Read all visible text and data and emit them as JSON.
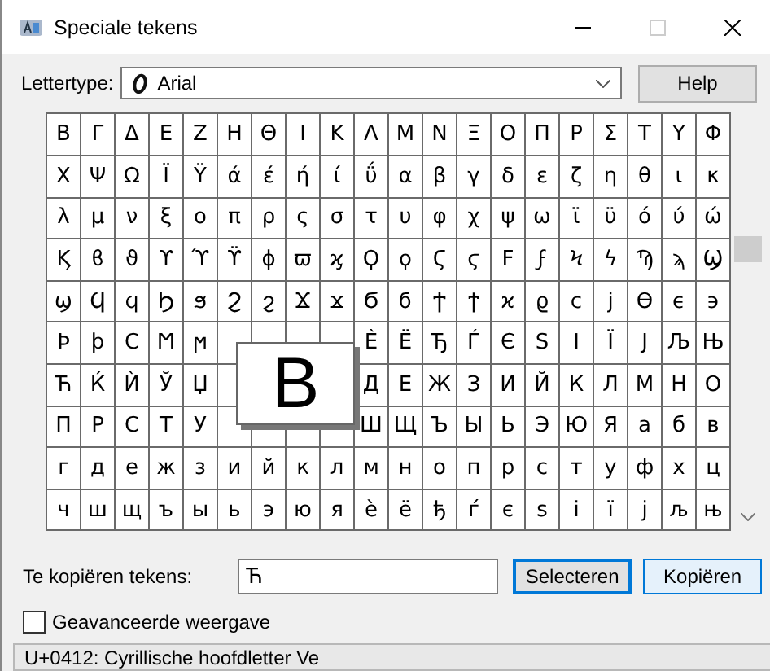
{
  "window": {
    "title": "Speciale tekens"
  },
  "font_picker": {
    "label": "Lettertype:",
    "value": "Arial"
  },
  "help_button": "Help",
  "grid": {
    "rows": [
      [
        "Β",
        "Γ",
        "Δ",
        "Ε",
        "Ζ",
        "Η",
        "Θ",
        "Ι",
        "Κ",
        "Λ",
        "Μ",
        "Ν",
        "Ξ",
        "Ο",
        "Π",
        "Ρ",
        "Σ",
        "Τ",
        "Υ",
        "Φ"
      ],
      [
        "Χ",
        "Ψ",
        "Ω",
        "Ϊ",
        "Ϋ",
        "ά",
        "έ",
        "ή",
        "ί",
        "ΰ",
        "α",
        "β",
        "γ",
        "δ",
        "ε",
        "ζ",
        "η",
        "θ",
        "ι",
        "κ"
      ],
      [
        "λ",
        "μ",
        "ν",
        "ξ",
        "ο",
        "π",
        "ρ",
        "ς",
        "σ",
        "τ",
        "υ",
        "φ",
        "χ",
        "ψ",
        "ω",
        "ϊ",
        "ϋ",
        "ό",
        "ύ",
        "ώ"
      ],
      [
        "Ϗ",
        "ϐ",
        "ϑ",
        "ϒ",
        "ϓ",
        "ϔ",
        "ϕ",
        "ϖ",
        "ϗ",
        "Ϙ",
        "ϙ",
        "Ϛ",
        "ϛ",
        "Ϝ",
        "ϝ",
        "Ϟ",
        "ϟ",
        "Ϡ",
        "ϡ",
        "Ϣ"
      ],
      [
        "ϣ",
        "Ϥ",
        "ϥ",
        "Ϧ",
        "ϧ",
        "Ϩ",
        "ϩ",
        "Ϫ",
        "ϫ",
        "Ϭ",
        "ϭ",
        "Ϯ",
        "ϯ",
        "ϰ",
        "ϱ",
        "ϲ",
        "ϳ",
        "ϴ",
        "ϵ",
        "϶"
      ],
      [
        "Ϸ",
        "ϸ",
        "Ϲ",
        "Ϻ",
        "ϻ",
        null,
        null,
        null,
        null,
        "Ѐ",
        "Ё",
        "Ђ",
        "Ѓ",
        "Є",
        "Ѕ",
        "І",
        "Ї",
        "Ј",
        "Љ",
        "Њ"
      ],
      [
        "Ћ",
        "Ќ",
        "Ѝ",
        "Ў",
        "Џ",
        null,
        null,
        null,
        null,
        "Д",
        "Е",
        "Ж",
        "З",
        "И",
        "Й",
        "К",
        "Л",
        "М",
        "Н",
        "О"
      ],
      [
        "П",
        "Р",
        "С",
        "Т",
        "У",
        null,
        null,
        null,
        null,
        "Ш",
        "Щ",
        "Ъ",
        "Ы",
        "Ь",
        "Э",
        "Ю",
        "Я",
        "а",
        "б",
        "в"
      ],
      [
        "г",
        "д",
        "е",
        "ж",
        "з",
        "и",
        "й",
        "к",
        "л",
        "м",
        "н",
        "о",
        "п",
        "р",
        "с",
        "т",
        "у",
        "ф",
        "х",
        "ц"
      ],
      [
        "ч",
        "ш",
        "щ",
        "ъ",
        "ы",
        "ь",
        "э",
        "ю",
        "я",
        "ѐ",
        "ё",
        "ђ",
        "ѓ",
        "є",
        "ѕ",
        "і",
        "ї",
        "ј",
        "љ",
        "њ"
      ]
    ],
    "magnified": "В"
  },
  "copy_field": {
    "label": "Te kopiëren tekens:",
    "value": "Ћ"
  },
  "buttons": [
    {
      "label": "Selecteren",
      "focused": true
    },
    {
      "label": "Kopiëren",
      "focused": false
    }
  ],
  "advanced_view": {
    "label": "Geavanceerde weergave",
    "checked": false
  },
  "status_bar": "U+0412: Cyrillische hoofdletter Ve"
}
